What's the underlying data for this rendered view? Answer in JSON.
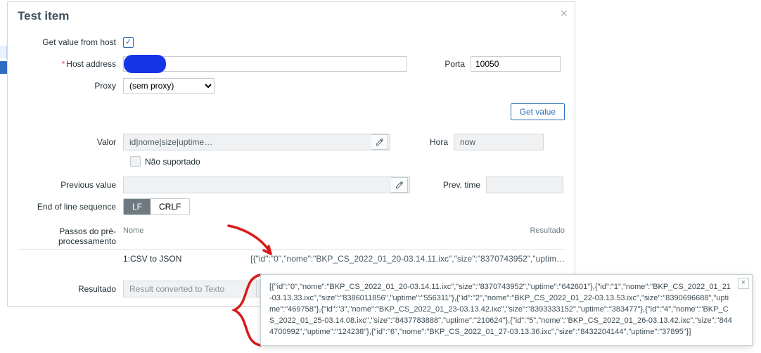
{
  "modal": {
    "title": "Test item",
    "close": "×"
  },
  "form": {
    "get_value_from_host_label": "Get value from host",
    "get_value_from_host_checked": true,
    "host_address_label": "Host address",
    "porta_label": "Porta",
    "porta_value": "10050",
    "proxy_label": "Proxy",
    "proxy_value": "(sem proxy)",
    "get_value_btn": "Get value",
    "valor_label": "Valor",
    "valor_value": "id|nome|size|uptime…",
    "hora_label": "Hora",
    "hora_value": "now",
    "nao_suportado_label": "Não suportado",
    "previous_value_label": "Previous value",
    "previous_value": "",
    "prev_time_label": "Prev. time",
    "prev_time_value": "",
    "eol_label": "End of line sequence",
    "eol_lf": "LF",
    "eol_crlf": "CRLF"
  },
  "preproc": {
    "section_label": "Passos do pré-processamento",
    "col_nome": "Nome",
    "col_resultado": "Resultado",
    "step_index": "1:",
    "step_name": "CSV to JSON",
    "step_result": "[{\"id\":\"0\",\"nome\":\"BKP_CS_2022_01_20-03.14.11.ixc\",\"size\":\"8370743952\",\"uptim…"
  },
  "resultado": {
    "label": "Resultado",
    "converted": "Result converted to Texto",
    "json": "[{\"id\":\"0\",\"nome\":\"BKP_CS_2022_01_20-03.14.11.ixc\",\"size\":\"8370743952\",\"uptim…"
  },
  "tooltip": {
    "close": "×",
    "text": "[{\"id\":\"0\",\"nome\":\"BKP_CS_2022_01_20-03.14.11.ixc\",\"size\":\"8370743952\",\"uptime\":\"642601\"},{\"id\":\"1\",\"nome\":\"BKP_CS_2022_01_21-03.13.33.ixc\",\"size\":\"8386011856\",\"uptime\":\"556311\"},{\"id\":\"2\",\"nome\":\"BKP_CS_2022_01_22-03.13.53.ixc\",\"size\":\"8390696688\",\"uptime\":\"469758\"},{\"id\":\"3\",\"nome\":\"BKP_CS_2022_01_23-03.13.42.ixc\",\"size\":\"8393333152\",\"uptime\":\"383477\"},{\"id\":\"4\",\"nome\":\"BKP_CS_2022_01_25-03.14.08.ixc\",\"size\":\"8437783888\",\"uptime\":\"210624\"},{\"id\":\"5\",\"nome\":\"BKP_CS_2022_01_26-03.13.42.ixc\",\"size\":\"8444700992\",\"uptime\":\"124238\"},{\"id\":\"6\",\"nome\":\"BKP_CS_2022_01_27-03.13.36.ixc\",\"size\":\"8432204144\",\"uptime\":\"37895\"}]"
  }
}
